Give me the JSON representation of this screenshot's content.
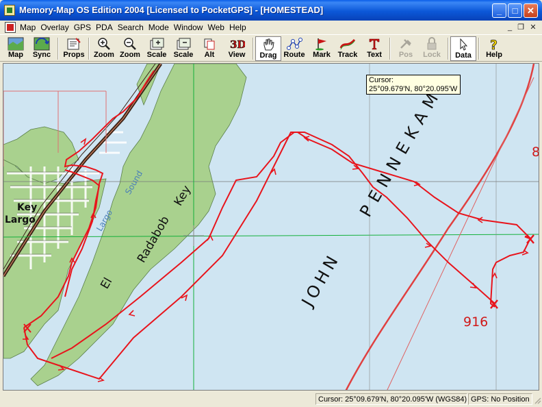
{
  "window": {
    "title": "Memory-Map OS Edition 2004 [Licensed to PocketGPS] - [HOMESTEAD]",
    "minimize_label": "_",
    "maximize_label": "□",
    "close_label": "✕"
  },
  "menu": {
    "items": [
      "Map",
      "Overlay",
      "GPS",
      "PDA",
      "Search",
      "Mode",
      "Window",
      "Web",
      "Help"
    ],
    "mdi_minimize": "_",
    "mdi_restore": "❐",
    "mdi_close": "✕"
  },
  "toolbar": {
    "buttons": [
      {
        "label": "Map",
        "icon": "map-icon"
      },
      {
        "label": "Sync",
        "icon": "sync-icon"
      },
      {
        "label": "Props",
        "icon": "properties-icon"
      },
      {
        "label": "Zoom",
        "icon": "zoom-in-icon"
      },
      {
        "label": "Zoom",
        "icon": "zoom-out-icon"
      },
      {
        "label": "Scale",
        "icon": "scale-up-icon"
      },
      {
        "label": "Scale",
        "icon": "scale-down-icon"
      },
      {
        "label": "Alt",
        "icon": "alternate-map-icon"
      },
      {
        "label": "View",
        "icon": "3d-view-icon"
      },
      {
        "label": "Drag",
        "icon": "hand-icon"
      },
      {
        "label": "Route",
        "icon": "route-icon"
      },
      {
        "label": "Mark",
        "icon": "flag-icon"
      },
      {
        "label": "Track",
        "icon": "track-icon"
      },
      {
        "label": "Text",
        "icon": "text-icon"
      },
      {
        "label": "Pos",
        "icon": "position-icon"
      },
      {
        "label": "Lock",
        "icon": "lock-icon"
      },
      {
        "label": "Data",
        "icon": "cursor-icon"
      },
      {
        "label": "Help",
        "icon": "help-icon"
      }
    ],
    "three_d_badge": "3D"
  },
  "map": {
    "labels": {
      "key_largo_1": "Key",
      "key_largo_2": "Largo",
      "el": "El",
      "radabob": "Radabob",
      "key": "Key",
      "largo_sound_1": "Largo",
      "largo_sound_2": "Sound",
      "john_pennekamp_1": "JOHN",
      "john_pennekamp_2": "PENNEKAMP",
      "depth_916": "916",
      "depth_8": "8"
    },
    "colors": {
      "water": "#cfe5f2",
      "land": "#a9d18e",
      "track": "#e8141c",
      "grid": "#12b03a"
    }
  },
  "tooltip": {
    "line1": "Cursor:",
    "line2": "25°09.679'N, 80°20.095'W"
  },
  "status": {
    "cursor": "Cursor: 25°09.679'N, 80°20.095'W (WGS84)",
    "gps": "GPS: No Position"
  }
}
